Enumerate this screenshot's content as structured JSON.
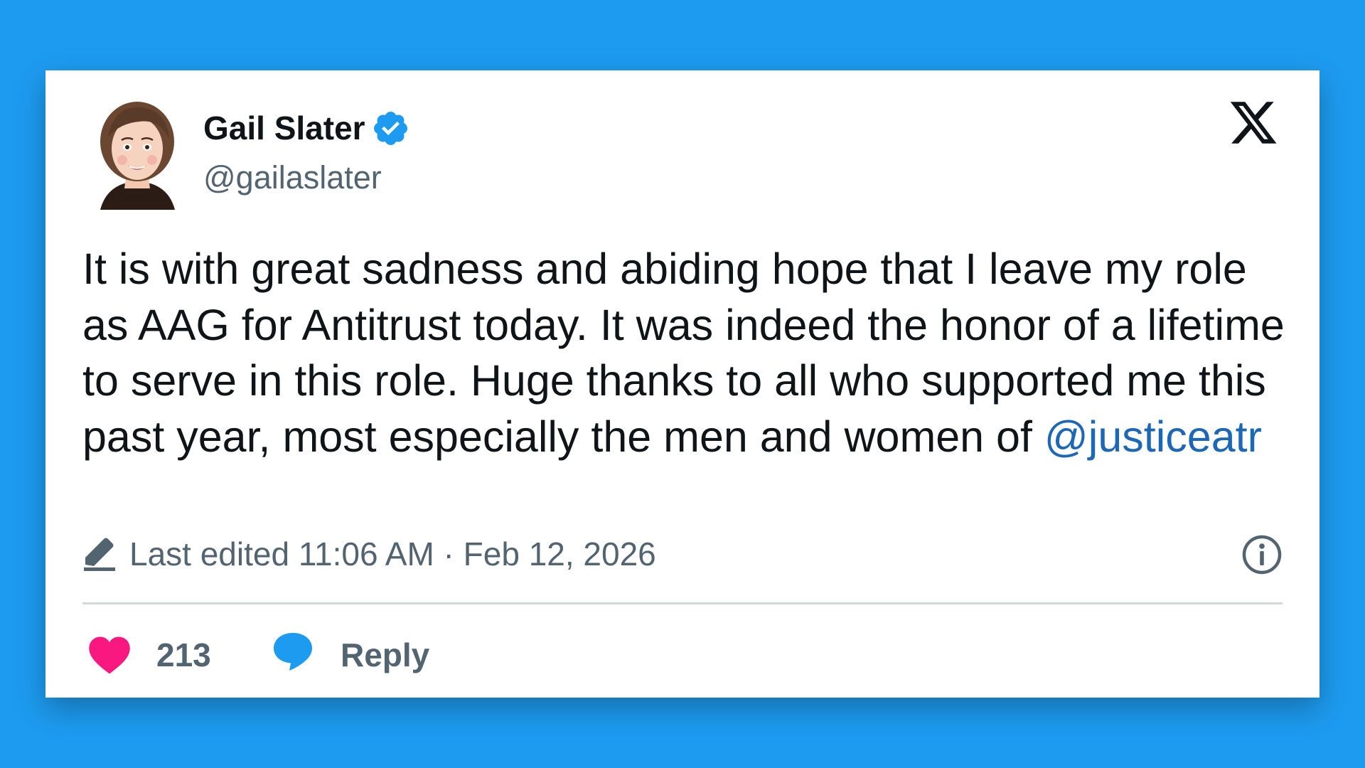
{
  "author": {
    "name": "Gail Slater",
    "handle": "@gailaslater",
    "verified": true
  },
  "tweet": {
    "text": "It is with great sadness and abiding hope that I leave my role as AAG for Antitrust today. It was indeed the honor of a lifetime to serve in this role. Huge thanks to all who supported me this past year, most especially the men and women of ",
    "mention": "@justiceatr"
  },
  "meta": {
    "edited_label": "Last edited 11:06 AM · Feb 12, 2026"
  },
  "actions": {
    "like_count": "213",
    "reply_label": "Reply"
  },
  "icons": {
    "platform": "x-logo-icon",
    "verified": "verified-badge-icon",
    "edit": "pencil-icon",
    "info": "info-icon",
    "like": "heart-icon",
    "reply": "speech-bubble-icon"
  },
  "colors": {
    "background": "#1d9bf0",
    "card": "#ffffff",
    "text": "#0f1419",
    "secondary_text": "#536471",
    "mention": "#1d67b7",
    "verified": "#1d9bf0",
    "heart": "#f91880",
    "reply_bubble": "#1d9bf0",
    "divider": "#cfd9de"
  }
}
